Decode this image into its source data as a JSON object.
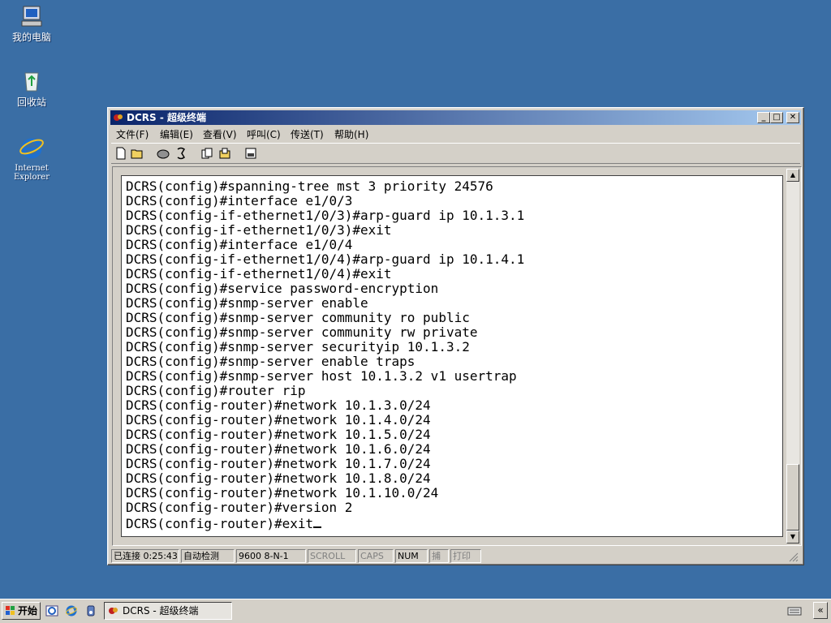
{
  "desktop": {
    "icons": [
      {
        "label": "我的电脑",
        "icon": "my-computer-icon"
      },
      {
        "label": "回收站",
        "icon": "recycle-bin-icon"
      },
      {
        "label": "Internet\nExplorer",
        "icon": "internet-explorer-icon"
      }
    ]
  },
  "window": {
    "title": "DCRS - 超级终端",
    "controls": {
      "minimize": "_",
      "maximize": "□",
      "close": "✕"
    },
    "menu": [
      "文件(F)",
      "编辑(E)",
      "查看(V)",
      "呼叫(C)",
      "传送(T)",
      "帮助(H)"
    ],
    "toolbar": [
      {
        "name": "new-connection",
        "icon": "new-document-icon"
      },
      {
        "name": "open",
        "icon": "open-folder-icon"
      },
      {
        "name": "call",
        "icon": "phone-icon"
      },
      {
        "name": "disconnect",
        "icon": "hangup-icon"
      },
      {
        "name": "send",
        "icon": "send-file-icon"
      },
      {
        "name": "receive",
        "icon": "receive-file-icon"
      },
      {
        "name": "properties",
        "icon": "properties-icon"
      }
    ],
    "terminal_lines": [
      "DCRS(config)#spanning-tree mst 3 priority 24576",
      "DCRS(config)#interface e1/0/3",
      "DCRS(config-if-ethernet1/0/3)#arp-guard ip 10.1.3.1",
      "DCRS(config-if-ethernet1/0/3)#exit",
      "DCRS(config)#interface e1/0/4",
      "DCRS(config-if-ethernet1/0/4)#arp-guard ip 10.1.4.1",
      "DCRS(config-if-ethernet1/0/4)#exit",
      "DCRS(config)#service password-encryption",
      "DCRS(config)#snmp-server enable",
      "DCRS(config)#snmp-server community ro public",
      "DCRS(config)#snmp-server community rw private",
      "DCRS(config)#snmp-server securityip 10.1.3.2",
      "DCRS(config)#snmp-server enable traps",
      "DCRS(config)#snmp-server host 10.1.3.2 v1 usertrap",
      "DCRS(config)#router rip",
      "DCRS(config-router)#network 10.1.3.0/24",
      "DCRS(config-router)#network 10.1.4.0/24",
      "DCRS(config-router)#network 10.1.5.0/24",
      "DCRS(config-router)#network 10.1.6.0/24",
      "DCRS(config-router)#network 10.1.7.0/24",
      "DCRS(config-router)#network 10.1.8.0/24",
      "DCRS(config-router)#network 10.1.10.0/24",
      "DCRS(config-router)#version 2",
      "DCRS(config-router)#exit"
    ],
    "status": {
      "connected": "已连接 0:25:43",
      "detect": "自动检测",
      "params": "9600 8-N-1",
      "scroll": "SCROLL",
      "caps": "CAPS",
      "num": "NUM",
      "capture": "捕",
      "print": "打印"
    }
  },
  "taskbar": {
    "start_label": "开始",
    "quicklaunch": [
      "ie-quick-icon",
      "browser-quick-icon",
      "media-quick-icon"
    ],
    "task_label": "DCRS - 超级终端",
    "tray_chevron": "«"
  },
  "colors": {
    "desktop": "#3a6ea5",
    "title_start": "#0a246a",
    "title_end": "#a6caf0",
    "chrome": "#d4d0c8"
  }
}
